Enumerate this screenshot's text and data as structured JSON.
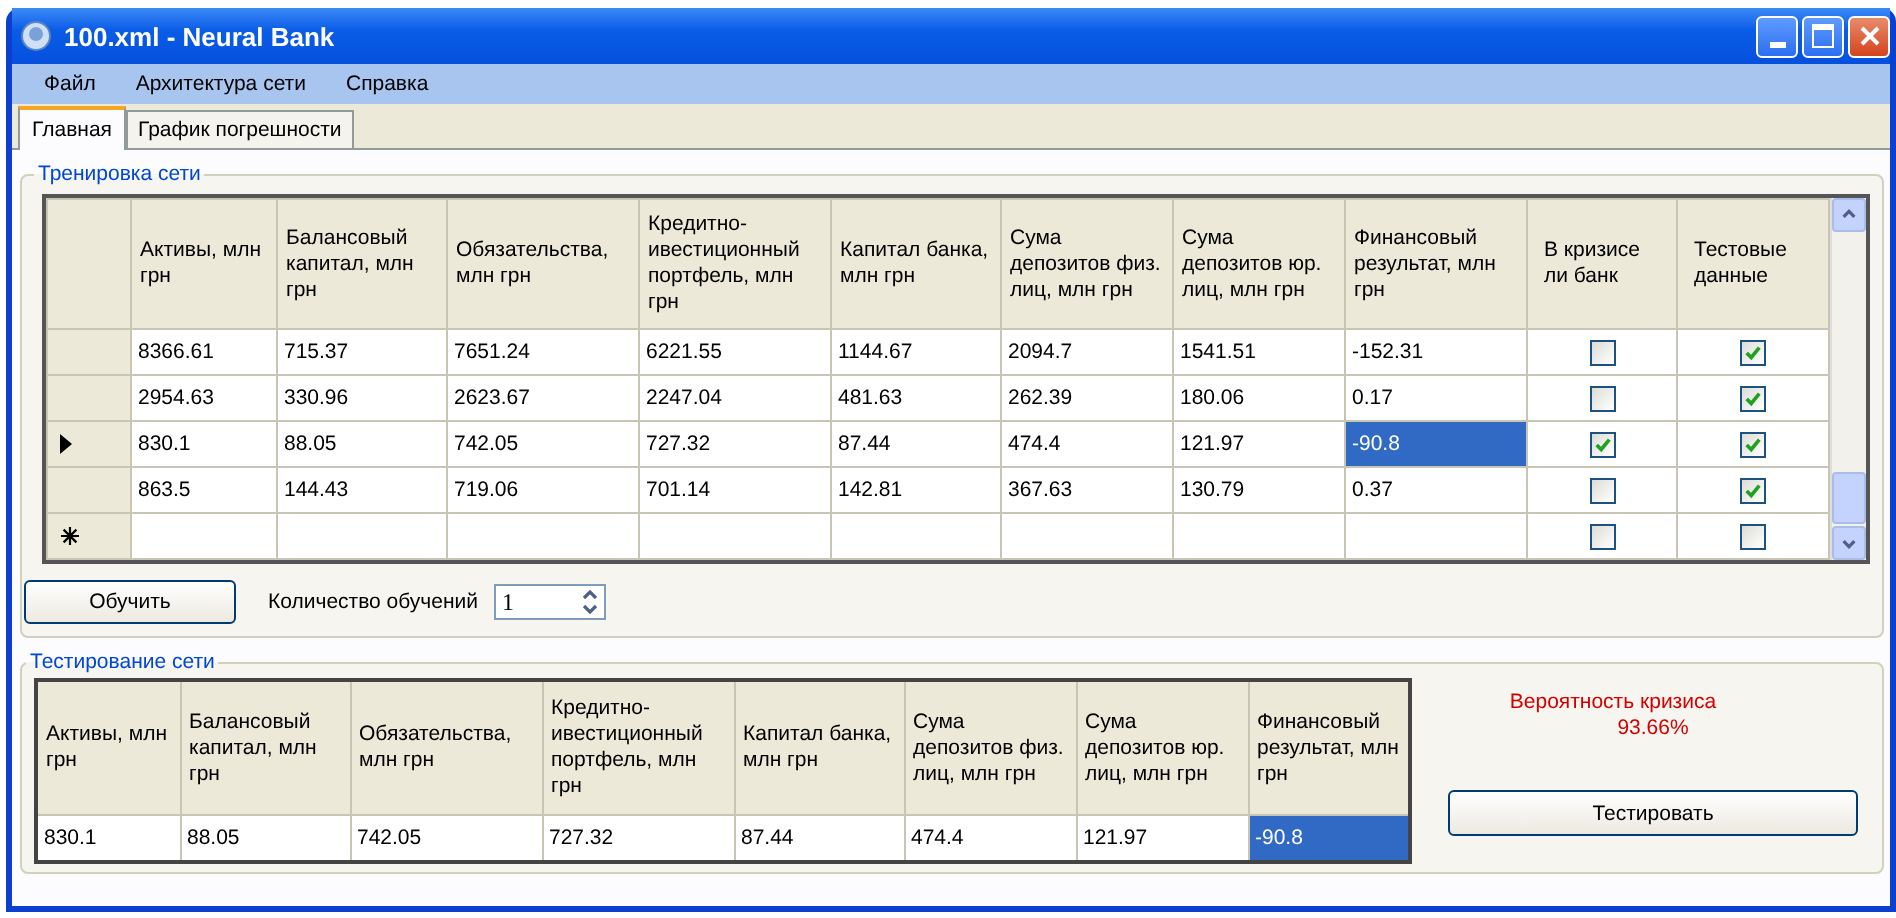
{
  "window": {
    "title": "100.xml - Neural Bank"
  },
  "menu": [
    "Файл",
    "Архитектура сети",
    "Справка"
  ],
  "tabs": [
    {
      "label": "Главная",
      "selected": true
    },
    {
      "label": "График погрешности",
      "selected": false
    }
  ],
  "training": {
    "title": "Тренировка сети",
    "columns": [
      "Активы, млн грн",
      "Балансовый капитал, млн грн",
      "Обязательства, млн грн",
      "Кредитно-ивестиционный портфель, млн грн",
      "Капитал банка, млн грн",
      "Сума депозитов физ. лиц, млн грн",
      "Сума депозитов юр. лиц, млн грн",
      "Финансовый результат, млн грн",
      "В кризисе ли банк",
      "Тестовые данные"
    ],
    "rows": [
      {
        "kind": "data",
        "current": false,
        "cells": [
          {
            "text": "8366.61",
            "selected": false
          },
          {
            "text": "715.37",
            "selected": false
          },
          {
            "text": "7651.24",
            "selected": false
          },
          {
            "text": "6221.55",
            "selected": false
          },
          {
            "text": "1144.67",
            "selected": false
          },
          {
            "text": "2094.7",
            "selected": false
          },
          {
            "text": "1541.51",
            "selected": false
          },
          {
            "text": "-152.31",
            "selected": false
          }
        ],
        "in_crisis": false,
        "test_data": true
      },
      {
        "kind": "data",
        "current": false,
        "cells": [
          {
            "text": "2954.63",
            "selected": false
          },
          {
            "text": "330.96",
            "selected": false
          },
          {
            "text": "2623.67",
            "selected": false
          },
          {
            "text": "2247.04",
            "selected": false
          },
          {
            "text": "481.63",
            "selected": false
          },
          {
            "text": "262.39",
            "selected": false
          },
          {
            "text": "180.06",
            "selected": false
          },
          {
            "text": "0.17",
            "selected": false
          }
        ],
        "in_crisis": false,
        "test_data": true
      },
      {
        "kind": "data",
        "current": true,
        "cells": [
          {
            "text": "830.1",
            "selected": false
          },
          {
            "text": "88.05",
            "selected": false
          },
          {
            "text": "742.05",
            "selected": false
          },
          {
            "text": "727.32",
            "selected": false
          },
          {
            "text": "87.44",
            "selected": false
          },
          {
            "text": "474.4",
            "selected": false
          },
          {
            "text": "121.97",
            "selected": false
          },
          {
            "text": "-90.8",
            "selected": true
          }
        ],
        "in_crisis": true,
        "test_data": true
      },
      {
        "kind": "data",
        "current": false,
        "cells": [
          {
            "text": "863.5",
            "selected": false
          },
          {
            "text": "144.43",
            "selected": false
          },
          {
            "text": "719.06",
            "selected": false
          },
          {
            "text": "701.14",
            "selected": false
          },
          {
            "text": "142.81",
            "selected": false
          },
          {
            "text": "367.63",
            "selected": false
          },
          {
            "text": "130.79",
            "selected": false
          },
          {
            "text": "0.37",
            "selected": false
          }
        ],
        "in_crisis": false,
        "test_data": true
      },
      {
        "kind": "new",
        "in_crisis": false,
        "test_data": false
      }
    ],
    "train_button": "Обучить",
    "count_label": "Количество обучений",
    "count_value": "1"
  },
  "testing": {
    "title": "Тестирование сети",
    "columns": [
      "Активы, млн грн",
      "Балансовый капитал, млн грн",
      "Обязательства, млн грн",
      "Кредитно-ивестиционный портфель, млн грн",
      "Капитал банка, млн грн",
      "Сума депозитов физ. лиц, млн грн",
      "Сума депозитов юр. лиц, млн грн",
      "Финансовый результат, млн грн"
    ],
    "cells": [
      {
        "text": "830.1",
        "selected": false
      },
      {
        "text": "88.05",
        "selected": false
      },
      {
        "text": "742.05",
        "selected": false
      },
      {
        "text": "727.32",
        "selected": false
      },
      {
        "text": "87.44",
        "selected": false
      },
      {
        "text": "474.4",
        "selected": false
      },
      {
        "text": "121.97",
        "selected": false
      },
      {
        "text": "-90.8",
        "selected": true
      }
    ],
    "probability_label": "Вероятность кризиса",
    "probability_value": "93.66%",
    "test_button": "Тестировать"
  }
}
